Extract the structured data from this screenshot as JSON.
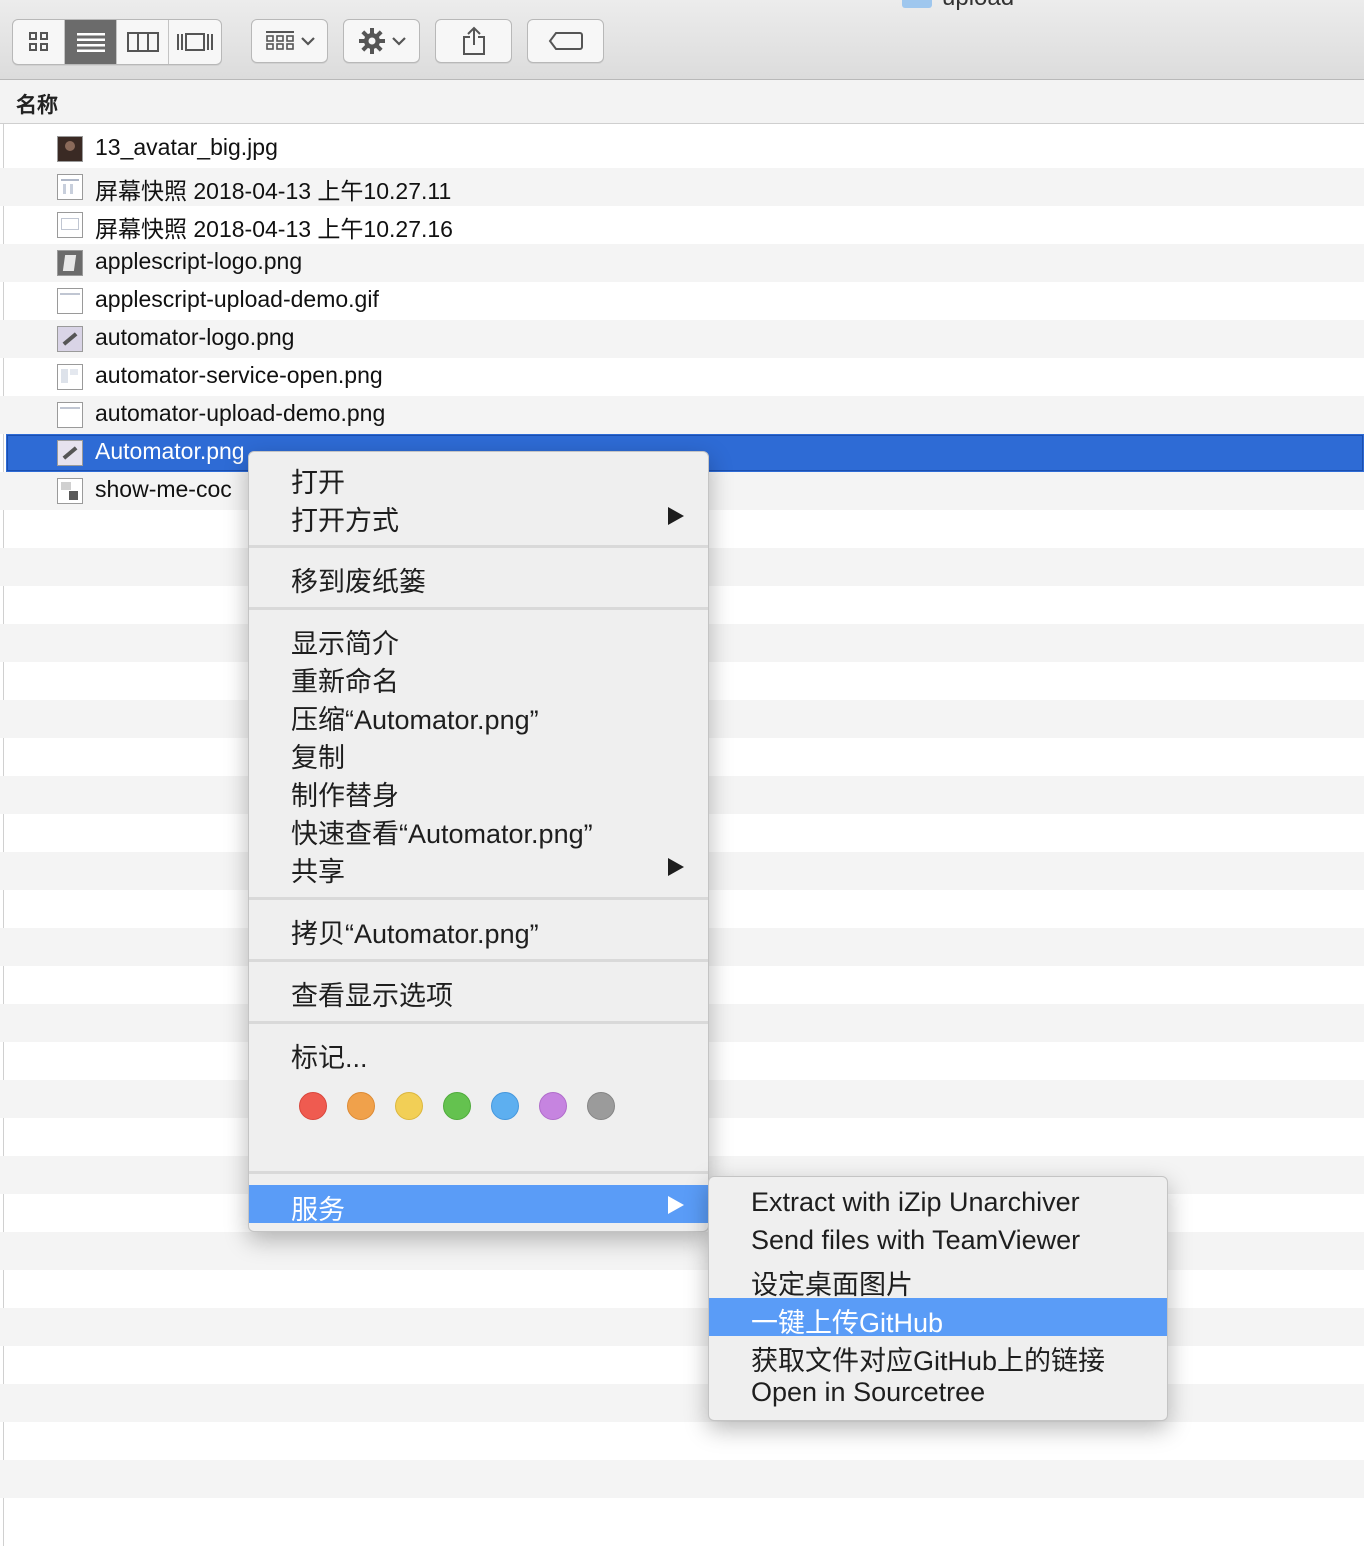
{
  "toolbar": {
    "view_modes": [
      {
        "icon": "icon-view-icon",
        "active": false
      },
      {
        "icon": "list-view-icon",
        "active": true
      },
      {
        "icon": "column-view-icon",
        "active": false
      },
      {
        "icon": "cover-flow-icon",
        "active": false
      }
    ],
    "group_button_icon": "group-grid-icon",
    "action_button_icon": "gear-icon",
    "share_button_icon": "share-icon",
    "tag_button_icon": "tag-icon",
    "folder_name": "upload"
  },
  "list": {
    "column_header": "名称",
    "files": [
      {
        "name": "13_avatar_big.jpg",
        "thumb": "photo"
      },
      {
        "name": "屏幕快照 2018-04-13 上午10.27.11",
        "thumb": "screenshot"
      },
      {
        "name": "屏幕快照 2018-04-13 上午10.27.16",
        "thumb": "screenshot"
      },
      {
        "name": "applescript-logo.png",
        "thumb": "logo"
      },
      {
        "name": "applescript-upload-demo.gif",
        "thumb": "screenshot"
      },
      {
        "name": "automator-logo.png",
        "thumb": "logo"
      },
      {
        "name": "automator-service-open.png",
        "thumb": "screenshot"
      },
      {
        "name": "automator-upload-demo.png",
        "thumb": "screenshot"
      },
      {
        "name": "Automator.png",
        "thumb": "logo",
        "selected": true
      },
      {
        "name": "show-me-coc",
        "thumb": "screenshot"
      }
    ]
  },
  "context_menu": {
    "items": {
      "open": "打开",
      "open_with": "打开方式",
      "move_to_trash": "移到废纸篓",
      "get_info": "显示简介",
      "rename": "重新命名",
      "compress": "压缩“Automator.png”",
      "duplicate": "复制",
      "make_alias": "制作替身",
      "quick_look": "快速查看“Automator.png”",
      "share": "共享",
      "copy": "拷贝“Automator.png”",
      "show_view_options": "查看显示选项",
      "tags": "标记...",
      "services": "服务"
    },
    "tag_colors": [
      "#ef5b50",
      "#f0a14b",
      "#f2cf56",
      "#64c24f",
      "#5daff0",
      "#c684e0",
      "#9b9b9b"
    ],
    "tag_border_colors": [
      "#d9463c",
      "#dd8a34",
      "#dcb73e",
      "#4fab3b",
      "#4597dc",
      "#b06ccb",
      "#858585"
    ]
  },
  "services_submenu": {
    "items": [
      "Extract with iZip Unarchiver",
      "Send files with TeamViewer",
      "设定桌面图片",
      "一键上传GitHub",
      "获取文件对应GitHub上的链接",
      "Open in Sourcetree"
    ],
    "highlighted_index": 3
  },
  "colors": {
    "selection": "#2e6bd5",
    "menu_highlight": "#5a9cf7"
  }
}
